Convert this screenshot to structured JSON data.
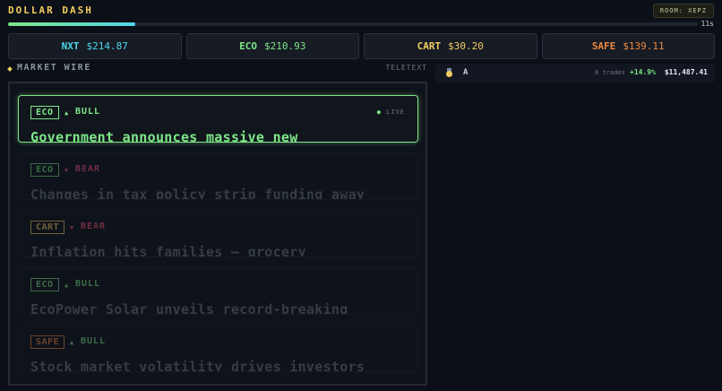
{
  "header": {
    "title": "DOLLAR DASH",
    "room": "ROOM: XEPZ",
    "timer_label": "11s",
    "timer_fraction": 0.185
  },
  "prices": [
    {
      "ticker": "NXT",
      "price": "$214.87",
      "color": "#4fd6ea"
    },
    {
      "ticker": "ECO",
      "price": "$210.93",
      "color": "#7ee787"
    },
    {
      "ticker": "CART",
      "price": "$30.20",
      "color": "#f2cc60"
    },
    {
      "ticker": "SAFE",
      "price": "$139.11",
      "color": "#f0883e"
    }
  ],
  "wire": {
    "title": "MARKET WIRE",
    "tag": "TELETEXT",
    "live_label": "LIVE",
    "items": [
      {
        "ticker": "ECO",
        "ticker_color": "#7ee787",
        "arrow": "▲",
        "sentiment": "BULL",
        "sentiment_color": "#7ee787",
        "headline": "Government announces massive new",
        "active": true
      },
      {
        "ticker": "ECO",
        "ticker_color": "#7ee787",
        "arrow": "▼",
        "sentiment": "BEAR",
        "sentiment_color": "#f85177",
        "headline": "Changes in tax policy strip funding away",
        "active": false
      },
      {
        "ticker": "CART",
        "ticker_color": "#f2cc60",
        "arrow": "▼",
        "sentiment": "BEAR",
        "sentiment_color": "#f85177",
        "headline": "Inflation hits families — grocery",
        "active": false
      },
      {
        "ticker": "ECO",
        "ticker_color": "#7ee787",
        "arrow": "▲",
        "sentiment": "BULL",
        "sentiment_color": "#7ee787",
        "headline": "EcoPower Solar unveils record-breaking",
        "active": false
      },
      {
        "ticker": "SAFE",
        "ticker_color": "#f0883e",
        "arrow": "▲",
        "sentiment": "BULL",
        "sentiment_color": "#7ee787",
        "headline": "Stock market volatility drives investors",
        "active": false
      }
    ]
  },
  "leaderboard": [
    {
      "name": "A",
      "trades": "8 trades",
      "change": "+14.9%",
      "worth": "$11,487.41",
      "medal": "gold-medal-icon"
    }
  ]
}
